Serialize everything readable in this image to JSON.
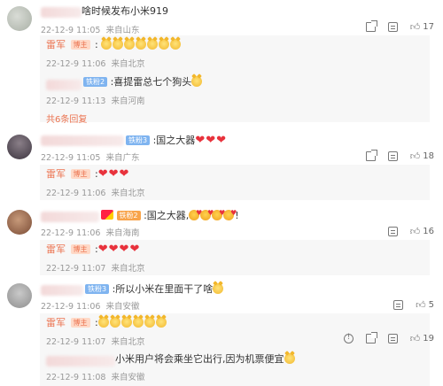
{
  "comments": [
    {
      "text": "啥时候发布小米919",
      "time": "22-12-9 11:05",
      "location": "来自山东",
      "share_count": "",
      "comment_count": "",
      "like_count": "17",
      "replies": [
        {
          "author": "雷军",
          "badge": "博主",
          "text": ":",
          "time": "22-12-9 11:06",
          "location": "来自北京"
        },
        {
          "author": "",
          "badge": "铁粉2",
          "text": ":喜提雷总七个狗头",
          "time": "22-12-9 11:13",
          "location": "来自河南"
        }
      ],
      "more_replies": "共6条回复"
    },
    {
      "badge": "铁粉3",
      "text": ":国之大器",
      "time": "22-12-9 11:05",
      "location": "来自广东",
      "like_count": "18",
      "replies": [
        {
          "author": "雷军",
          "badge": "博主",
          "text": ":",
          "time": "22-12-9 11:06",
          "location": "来自北京"
        }
      ]
    },
    {
      "badge": "铁粉2",
      "text": ":国之大器,",
      "text_suffix": "!",
      "time": "22-12-9 11:06",
      "location": "来自海南",
      "like_count": "16",
      "replies": [
        {
          "author": "雷军",
          "badge": "博主",
          "text": ":",
          "time": "22-12-9 11:07",
          "location": "来自北京"
        }
      ]
    },
    {
      "badge": "铁粉3",
      "text": ":所以小米在里面干了啥",
      "time": "22-12-9 11:06",
      "location": "来自安徽",
      "like_count": "5",
      "replies": [
        {
          "author": "雷军",
          "badge": "博主",
          "text": ":",
          "time": "22-12-9 11:07",
          "location": "来自北京",
          "like_count": "19"
        },
        {
          "author": "",
          "text": "小米用户将会乘坐它出行,因为机票便宜",
          "time": "22-12-9 11:08",
          "location": "来自安徽"
        }
      ]
    }
  ],
  "icons": [
    "share-icon",
    "comment-icon",
    "like-icon",
    "report-icon",
    "doge-emoji",
    "heart-emoji",
    "kiss-emoji",
    "china-flag-emoji"
  ],
  "colors": {
    "accent": "#eb7350",
    "meta": "#999999",
    "heart": "#e8323c",
    "vip_badge": "#7fb4f0"
  }
}
